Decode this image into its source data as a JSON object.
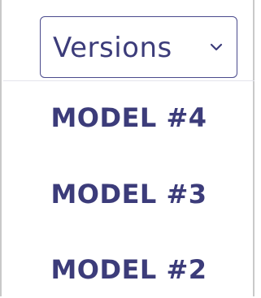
{
  "dropdown": {
    "toggle_label": "Versions",
    "toggle_icon": "chevron-down-icon",
    "items": [
      {
        "label": "MODEL #4"
      },
      {
        "label": "MODEL #3"
      },
      {
        "label": "MODEL #2"
      }
    ]
  },
  "colors": {
    "text": "#3c3c7a",
    "border": "#4a4a8c",
    "panel_border": "#c9c9c9",
    "separator": "#e4e4ec",
    "background": "#ffffff"
  }
}
